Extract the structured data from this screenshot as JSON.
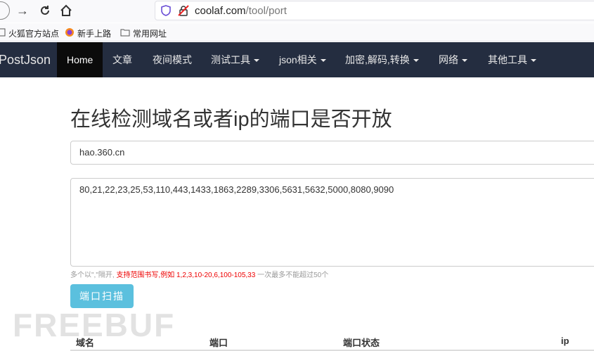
{
  "browser": {
    "url_domain": "coolaf.com",
    "url_path": "/tool/port"
  },
  "bookmarks": [
    {
      "label": "火狐官方站点",
      "icon": "page-icon"
    },
    {
      "label": "新手上路",
      "icon": "firefox-icon"
    },
    {
      "label": "常用网址",
      "icon": "folder-icon"
    }
  ],
  "navbar": {
    "brand": "PostJson",
    "items": [
      "Home",
      "文章",
      "夜间模式",
      "测试工具",
      "json相关",
      "加密,解码,转换",
      "网络",
      "其他工具"
    ]
  },
  "main": {
    "title": "在线检测域名或者ip的端口是否开放",
    "domain_value": "hao.360.cn",
    "ports_value": "80,21,22,23,25,53,110,443,1433,1863,2289,3306,5631,5632,5000,8080,9090",
    "hint_prefix": "多个以\",\"隔开,",
    "hint_red": "支持范围书写,例如 1,2,3,10-20,6,100-105,33",
    "hint_suffix": "一次最多不能超过50个",
    "scan_button": "端口扫描"
  },
  "table": {
    "headers": [
      "域名",
      "端口",
      "端口状态",
      "ip"
    ]
  },
  "watermark": "FREEBUF",
  "colors": {
    "navbar_bg": "#242d40",
    "nav_active_bg": "#0b0b0b",
    "scan_button_bg": "#5bc0de",
    "hint_red": "#e00000"
  }
}
